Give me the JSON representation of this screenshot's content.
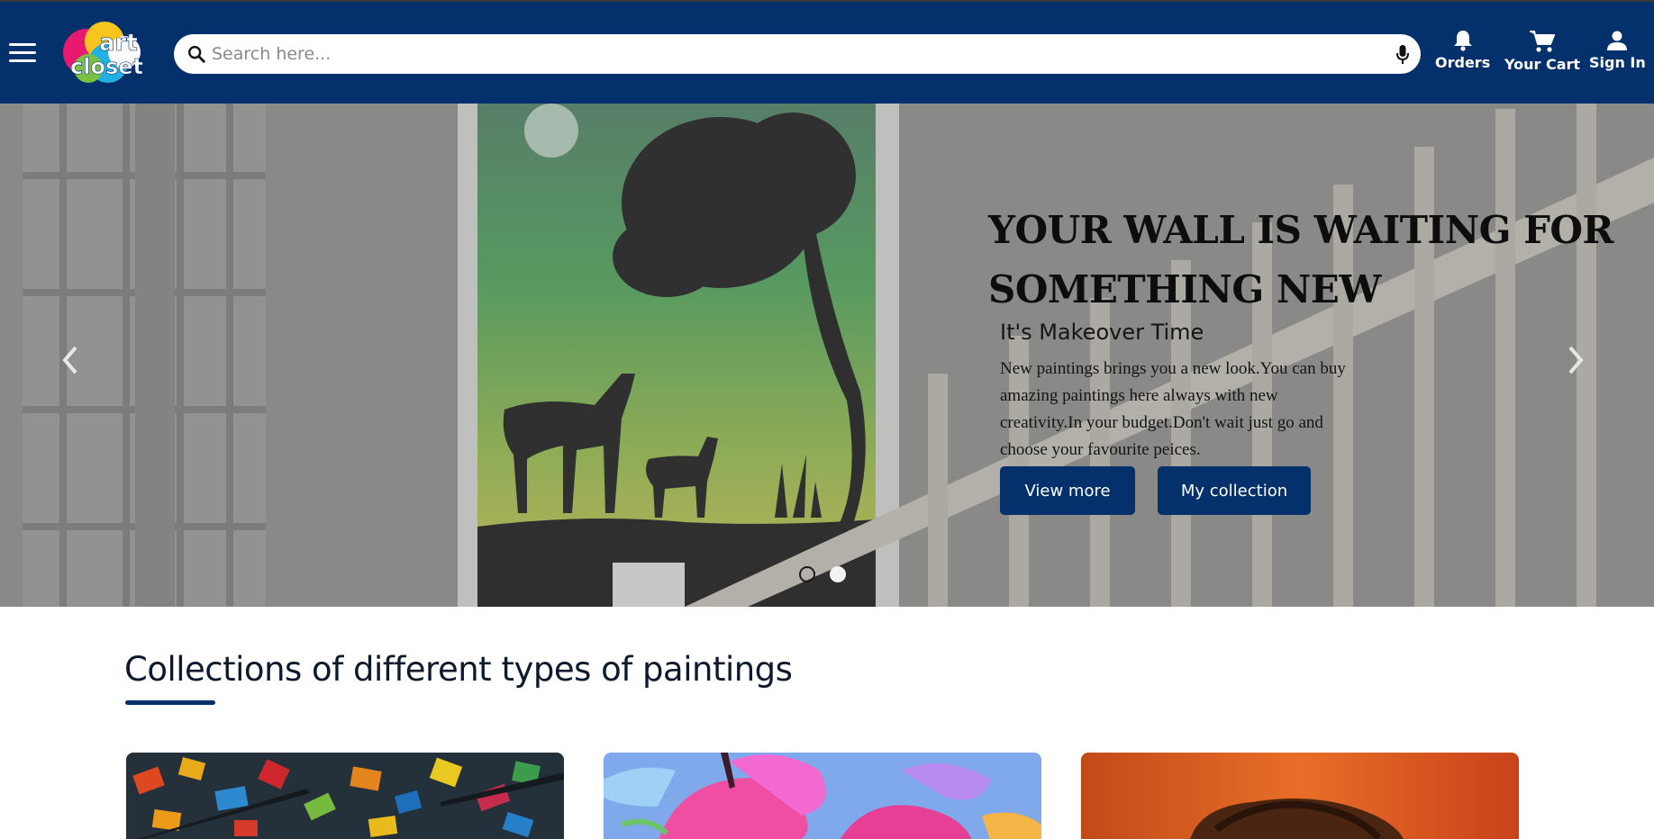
{
  "header": {
    "search_placeholder": "Search here...",
    "nav": {
      "orders": "Orders",
      "cart": "Your Cart",
      "signin": "Sign In"
    }
  },
  "hero": {
    "heading_line1": "YOUR WALL IS WAITING FOR",
    "heading_line2": "SOMETHING NEW",
    "subheading": "It's Makeover Time",
    "body": "New paintings brings you a new look.You can buy amazing paintings here always with new creativity.In your budget.Don't wait just go and choose your favourite peices.",
    "buttons": {
      "view_more": "View more",
      "my_collection": "My collection"
    },
    "carousel": {
      "slides": 2,
      "active_index": 1
    }
  },
  "collections": {
    "title": "Collections of different types of paintings"
  },
  "colors": {
    "brand_navy": "#04306b",
    "hero_overlay": "#8d8e8c"
  },
  "icons": [
    "menu-icon",
    "search-icon",
    "mic-icon",
    "bell-icon",
    "cart-icon",
    "user-icon",
    "chevron-left-icon",
    "chevron-right-icon"
  ]
}
